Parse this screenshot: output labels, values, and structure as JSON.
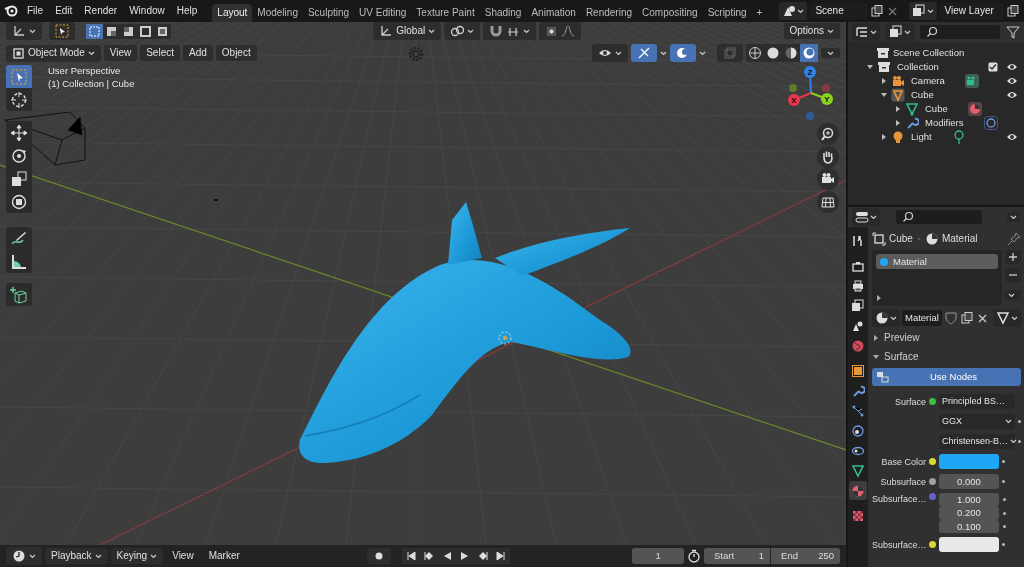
{
  "menu": [
    "File",
    "Edit",
    "Render",
    "Window",
    "Help"
  ],
  "workspaces": [
    {
      "label": "Layout",
      "selected": true
    },
    {
      "label": "Modeling",
      "selected": false
    },
    {
      "label": "Sculpting",
      "selected": false
    },
    {
      "label": "UV Editing",
      "selected": false
    },
    {
      "label": "Texture Paint",
      "selected": false
    },
    {
      "label": "Shading",
      "selected": false
    },
    {
      "label": "Animation",
      "selected": false
    },
    {
      "label": "Rendering",
      "selected": false
    },
    {
      "label": "Compositing",
      "selected": false
    },
    {
      "label": "Scripting",
      "selected": false
    }
  ],
  "add_workspace": "+",
  "scene": "Scene",
  "view_layer": "View Layer",
  "viewport": {
    "orientation": "Global",
    "options": "Options",
    "mode": "Object Mode",
    "menus": [
      "View",
      "Select",
      "Add",
      "Object"
    ],
    "select_modes": [
      {
        "selected": true
      },
      {
        "selected": false
      },
      {
        "selected": false
      },
      {
        "selected": false
      },
      {
        "selected": false
      }
    ],
    "shading_modes": [
      {
        "kind": "wireframe",
        "selected": false
      },
      {
        "kind": "solid",
        "selected": false
      },
      {
        "kind": "material",
        "selected": false
      },
      {
        "kind": "rendered",
        "selected": true
      }
    ],
    "view_name": "User Perspective",
    "object_info": "(1) Collection | Cube",
    "axes": [
      "X",
      "Y",
      "Z"
    ],
    "tool_groups": [
      {
        "tools": [
          {
            "kind": "select",
            "selected": true
          },
          {
            "kind": "cursor",
            "selected": false
          }
        ]
      },
      {
        "tools": [
          {
            "kind": "move",
            "selected": false
          },
          {
            "kind": "rotate",
            "selected": false
          },
          {
            "kind": "scale",
            "selected": false
          },
          {
            "kind": "transform",
            "selected": false
          }
        ]
      },
      {
        "tools": [
          {
            "kind": "annotate",
            "selected": false
          },
          {
            "kind": "measure",
            "selected": false
          }
        ]
      },
      {
        "tools": [
          {
            "kind": "add_cube",
            "selected": false
          }
        ]
      }
    ]
  },
  "outliner": {
    "root": "Scene Collection",
    "items": [
      {
        "label": "Collection",
        "kind": "collection",
        "expanded": true,
        "checked": true,
        "children": [
          {
            "label": "Camera",
            "kind": "camera",
            "expanded": false
          },
          {
            "label": "Cube",
            "kind": "object",
            "expanded": true,
            "children": [
              {
                "label": "Cube",
                "kind": "mesh",
                "expanded": false
              },
              {
                "label": "Modifiers",
                "kind": "modifiers",
                "expanded": false
              }
            ]
          },
          {
            "label": "Light",
            "kind": "light",
            "expanded": false
          }
        ]
      }
    ]
  },
  "properties": {
    "tabs": [
      {
        "kind": "tool",
        "selected": false
      },
      {
        "kind": "render",
        "selected": false
      },
      {
        "kind": "output",
        "selected": false
      },
      {
        "kind": "view_layer",
        "selected": false
      },
      {
        "kind": "scene",
        "selected": false
      },
      {
        "kind": "world",
        "selected": false
      },
      {
        "kind": "object",
        "selected": false
      },
      {
        "kind": "modifiers",
        "selected": false
      },
      {
        "kind": "particles",
        "selected": false
      },
      {
        "kind": "physics",
        "selected": false
      },
      {
        "kind": "constraints",
        "selected": false
      },
      {
        "kind": "data",
        "selected": false
      },
      {
        "kind": "material",
        "selected": true
      },
      {
        "kind": "texture",
        "selected": false
      }
    ],
    "breadcrumb": [
      "Cube",
      "Material"
    ],
    "slots": [
      {
        "label": "Material",
        "selected": true
      }
    ],
    "material_name": "Material",
    "panels": [
      {
        "label": "Preview",
        "expanded": false
      },
      {
        "label": "Surface",
        "expanded": true
      }
    ],
    "use_nodes": "Use Nodes",
    "surface_label": "Surface",
    "surface_value": "Principled BS…",
    "distribution": "GGX",
    "subsurface_method": "Christensen-B…",
    "fields": [
      {
        "label": "Base Color",
        "kind": "color",
        "color": "#1ea7f5"
      },
      {
        "label": "Subsurface",
        "kind": "number",
        "value": "0.000"
      },
      {
        "label": "Subsurface…",
        "kind": "vector",
        "values": [
          "1.000",
          "0.200",
          "0.100"
        ]
      },
      {
        "label": "Subsurface…",
        "kind": "color",
        "color": "#e8e8e8"
      }
    ]
  },
  "timeline": {
    "menus": [
      {
        "label": "Playback",
        "kind": "dropdown"
      },
      {
        "label": "Keying",
        "kind": "dropdown"
      },
      {
        "label": "View",
        "kind": "menu"
      },
      {
        "label": "Marker",
        "kind": "menu"
      }
    ],
    "current_frame": "1",
    "start_label": "Start",
    "start": "1",
    "end_label": "End",
    "end": "250"
  }
}
